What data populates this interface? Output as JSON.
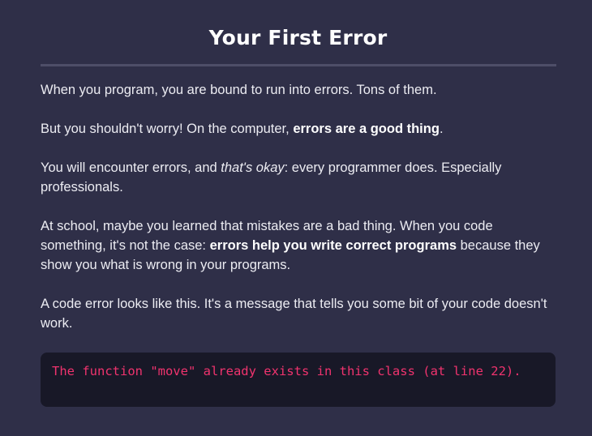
{
  "lesson": {
    "title": "Your First Error"
  },
  "paragraphs": [
    {
      "text": "When you program, you are bound to run into errors. Tons of them."
    },
    {
      "before": "But you shouldn't worry! On the computer, ",
      "bold": "errors are a good thing",
      "after": "."
    },
    {
      "before": "You will encounter errors, and ",
      "italic": "that's okay",
      "after": ": every programmer does. Especially professionals."
    },
    {
      "before": "At school, maybe you learned that mistakes are a bad thing. When you code something, it's not the case: ",
      "bold": "errors help you write correct programs",
      "after": " because they show you what is wrong in your programs."
    },
    {
      "text": "A code error looks like this. It's a message that tells you some bit of your code doesn't work."
    }
  ],
  "error_example": {
    "message": "The function \"move\" already exists in this class (at line 22)."
  },
  "colors": {
    "background": "#2f2f48",
    "error_text": "#f0336e",
    "error_background": "#181827"
  }
}
